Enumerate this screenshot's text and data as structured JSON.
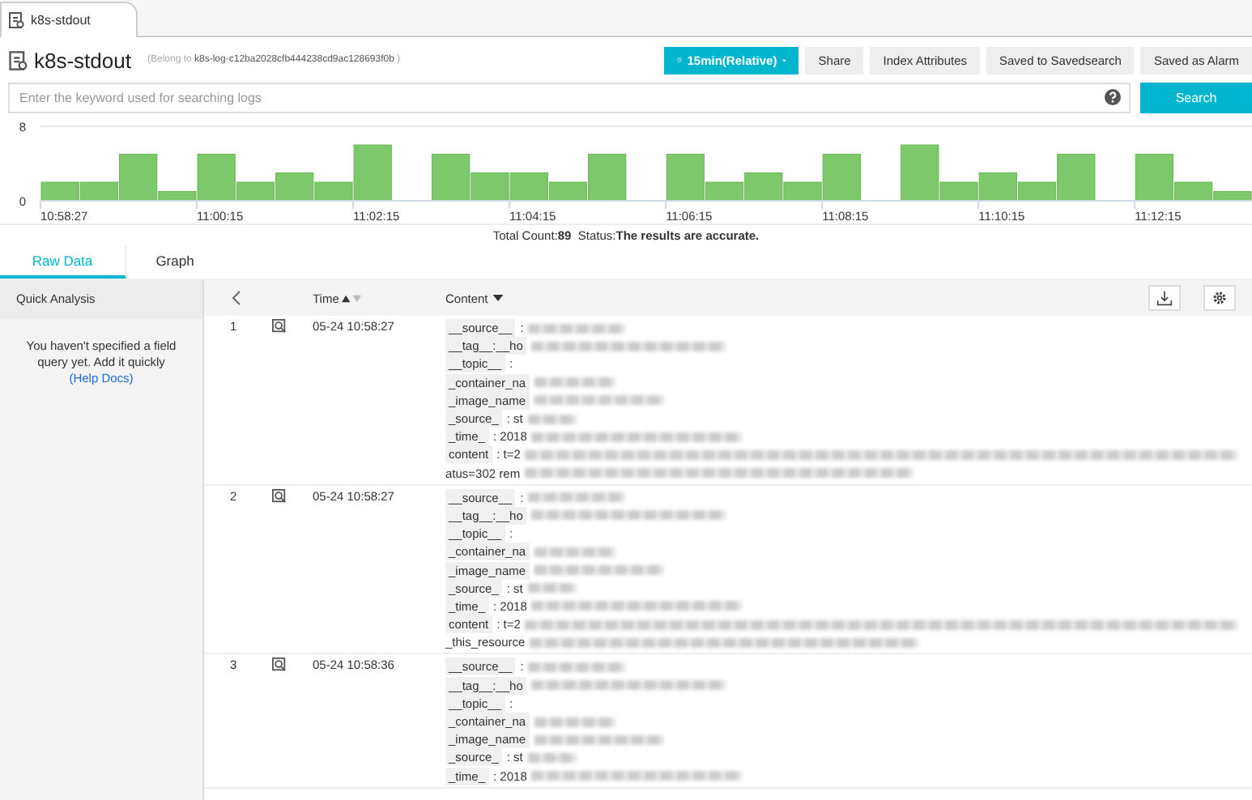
{
  "top_tab": {
    "label": "k8s-stdout",
    "selected": true
  },
  "header": {
    "title": "k8s-stdout",
    "belong_prefix": "(Belong to",
    "belong_name": "k8s-log-c12ba2028cfb444238cd9ac128693f0b",
    "belong_suffix": ")"
  },
  "toolbar": {
    "time_range": "15min(Relative)",
    "buttons": [
      "Share",
      "Index Attributes",
      "Saved to Savedsearch",
      "Saved as Alarm"
    ]
  },
  "search": {
    "placeholder": "Enter the keyword used for searching logs",
    "button": "Search"
  },
  "histogram": {
    "chart_data": {
      "type": "bar",
      "categories": [
        "10:58:27",
        null,
        null,
        null,
        "11:00:15",
        null,
        null,
        null,
        "11:02:15",
        null,
        null,
        null,
        "11:04:15",
        null,
        null,
        null,
        "11:06:15",
        null,
        null,
        null,
        "11:08:15",
        null,
        null,
        null,
        "11:10:15",
        null,
        null,
        null,
        "11:12:15",
        null,
        null
      ],
      "values": [
        2,
        2,
        5,
        1,
        5,
        2,
        3,
        2,
        6,
        0,
        5,
        3,
        3,
        2,
        5,
        0,
        5,
        2,
        3,
        2,
        5,
        0,
        6,
        2,
        3,
        2,
        5,
        0,
        5,
        2,
        1
      ],
      "ylim": [
        0,
        8
      ],
      "yticks": [
        0,
        8
      ]
    }
  },
  "summary": {
    "count_label": "Total Count:",
    "count": "89",
    "status_label": "Status:",
    "status": "The results are accurate."
  },
  "view_tabs": [
    {
      "label": "Raw Data",
      "selected": true
    },
    {
      "label": "Graph",
      "selected": false
    }
  ],
  "quick_analysis": {
    "title": "Quick Analysis",
    "message": "You haven't specified a field query yet. Add it quickly",
    "link": "(Help Docs)"
  },
  "table": {
    "columns": [
      "Time",
      "Content"
    ],
    "rows": [
      {
        "number": "1",
        "time": "05-24 10:58:27",
        "lines": [
          {
            "kind": "field",
            "key": "__source__",
            "value": ":",
            "redacted": true
          },
          {
            "kind": "field",
            "key": "__tag__:__ho",
            "redacted": true
          },
          {
            "kind": "field",
            "key": "__topic__",
            "value": ":",
            "redacted": false
          },
          {
            "kind": "field",
            "key": "_container_na",
            "redacted": true
          },
          {
            "kind": "field",
            "key": "_image_name",
            "redacted": true
          },
          {
            "kind": "field",
            "key": "_source_",
            "value": ":  st",
            "redacted": true
          },
          {
            "kind": "field",
            "key": "_time_",
            "value": ":  2018",
            "redacted": true
          },
          {
            "kind": "field",
            "key": "content",
            "value": ":  t=2",
            "redacted": true
          },
          {
            "kind": "wrap",
            "value": "atus=302  rem",
            "redacted": true
          }
        ]
      },
      {
        "number": "2",
        "time": "05-24 10:58:27",
        "lines": [
          {
            "kind": "field",
            "key": "__source__",
            "value": ":",
            "redacted": true
          },
          {
            "kind": "field",
            "key": "__tag__:__ho",
            "redacted": true
          },
          {
            "kind": "field",
            "key": "__topic__",
            "value": ":",
            "redacted": false
          },
          {
            "kind": "field",
            "key": "_container_na",
            "redacted": true
          },
          {
            "kind": "field",
            "key": "_image_name",
            "redacted": true
          },
          {
            "kind": "field",
            "key": "_source_",
            "value": ":  st",
            "redacted": true
          },
          {
            "kind": "field",
            "key": "_time_",
            "value": ":  2018",
            "redacted": true
          },
          {
            "kind": "field",
            "key": "content",
            "value": ":  t=2",
            "redacted": true
          },
          {
            "kind": "wrap",
            "value": "_this_resource",
            "redacted": true
          }
        ]
      },
      {
        "number": "3",
        "time": "05-24 10:58:36",
        "lines": [
          {
            "kind": "field",
            "key": "__source__",
            "value": ":",
            "redacted": true
          },
          {
            "kind": "field",
            "key": "__tag__:__ho",
            "redacted": true
          },
          {
            "kind": "field",
            "key": "__topic__",
            "value": ":",
            "redacted": false
          },
          {
            "kind": "field",
            "key": "_container_na",
            "redacted": true
          },
          {
            "kind": "field",
            "key": "_image_name",
            "redacted": true
          },
          {
            "kind": "field",
            "key": "_source_",
            "value": ":  st",
            "redacted": true
          },
          {
            "kind": "field",
            "key": "_time_",
            "value": ":  2018",
            "redacted": true
          }
        ]
      }
    ]
  }
}
